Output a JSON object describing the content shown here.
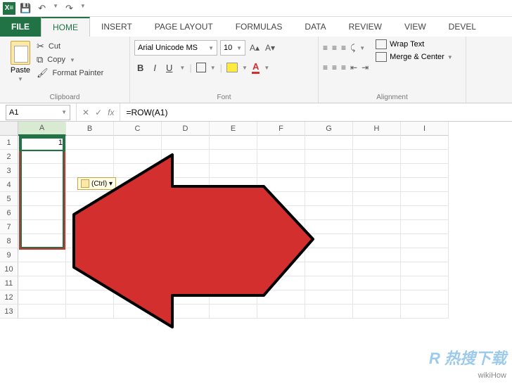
{
  "qat": {
    "save": "💾",
    "undo": "↶",
    "redo": "↷"
  },
  "tabs": [
    "FILE",
    "HOME",
    "INSERT",
    "PAGE LAYOUT",
    "FORMULAS",
    "DATA",
    "REVIEW",
    "VIEW",
    "DEVEL"
  ],
  "active_tab": 1,
  "ribbon": {
    "clipboard": {
      "paste": "Paste",
      "cut": "Cut",
      "copy": "Copy",
      "format_painter": "Format Painter",
      "label": "Clipboard"
    },
    "font": {
      "name": "Arial Unicode MS",
      "size": "10",
      "grow": "A▴",
      "shrink": "A▾",
      "bold": "B",
      "italic": "I",
      "underline": "U",
      "font_color": "A",
      "label": "Font"
    },
    "alignment": {
      "wrap": "Wrap Text",
      "merge": "Merge & Center",
      "label": "Alignment"
    }
  },
  "name_box": "A1",
  "formula": "=ROW(A1)",
  "columns": [
    "A",
    "B",
    "C",
    "D",
    "E",
    "F",
    "G",
    "H",
    "I"
  ],
  "rows": [
    "1",
    "2",
    "3",
    "4",
    "5",
    "6",
    "7",
    "8",
    "9",
    "10",
    "11",
    "12",
    "13"
  ],
  "cell_a1": "1",
  "paste_options": "(Ctrl) ▾",
  "watermark": "wikiHow",
  "watermark2": "R 热搜下载"
}
